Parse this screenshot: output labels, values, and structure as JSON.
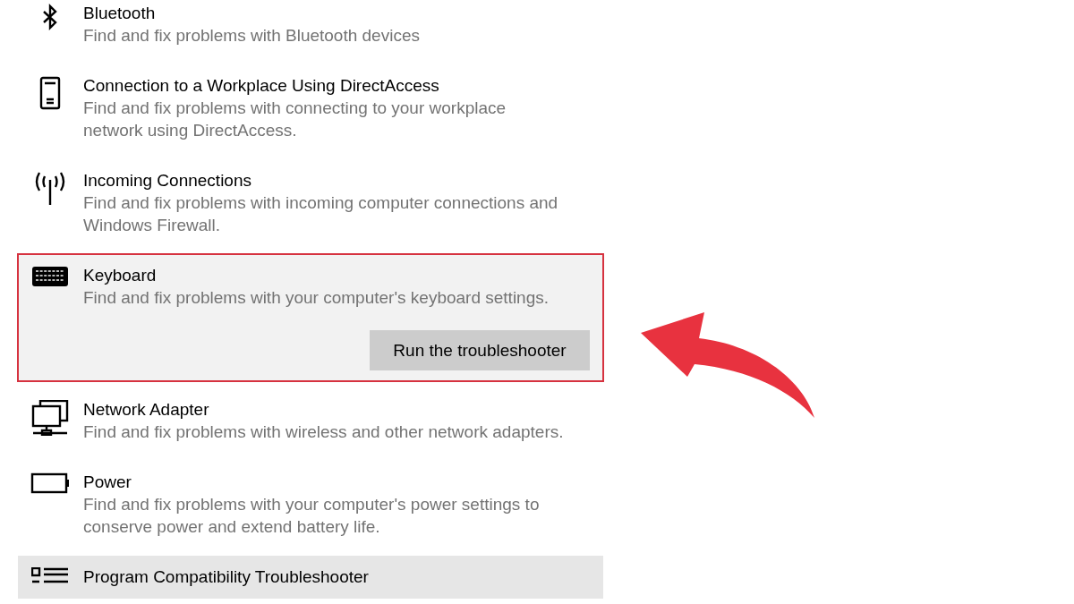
{
  "troubleshooters": [
    {
      "kind": "bluetooth",
      "title": "Bluetooth",
      "description": "Find and fix problems with Bluetooth devices",
      "selected": false,
      "hovered": false
    },
    {
      "kind": "phone",
      "title": "Connection to a Workplace Using DirectAccess",
      "description": "Find and fix problems with connecting to your workplace network using DirectAccess.",
      "selected": false,
      "hovered": false
    },
    {
      "kind": "antenna",
      "title": "Incoming Connections",
      "description": "Find and fix problems with incoming computer connections and Windows Firewall.",
      "selected": false,
      "hovered": false
    },
    {
      "kind": "keyboard",
      "title": "Keyboard",
      "description": "Find and fix problems with your computer's keyboard settings.",
      "selected": true,
      "hovered": false,
      "button": "Run the troubleshooter"
    },
    {
      "kind": "network",
      "title": "Network Adapter",
      "description": "Find and fix problems with wireless and other network adapters.",
      "selected": false,
      "hovered": false
    },
    {
      "kind": "battery",
      "title": "Power",
      "description": "Find and fix problems with your computer's power settings to conserve power and extend battery life.",
      "selected": false,
      "hovered": false
    },
    {
      "kind": "list",
      "title": "Program Compatibility Troubleshooter",
      "selected": false,
      "hovered": true
    }
  ]
}
